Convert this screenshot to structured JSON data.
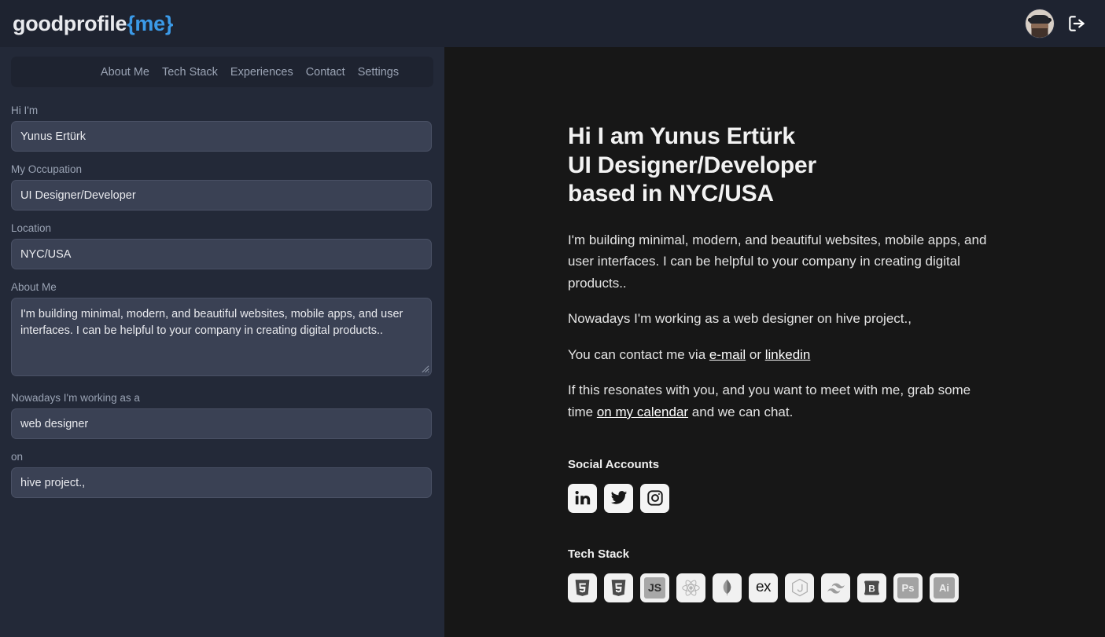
{
  "header": {
    "logo_main": "goodprofile",
    "logo_accent": "{me}",
    "avatar_name": "avatar",
    "logout_name": "logout-icon"
  },
  "nav": {
    "items": [
      {
        "label": "About Me"
      },
      {
        "label": "Tech Stack"
      },
      {
        "label": "Experiences"
      },
      {
        "label": "Contact"
      },
      {
        "label": "Settings"
      }
    ]
  },
  "form": {
    "fields": [
      {
        "label": "Hi I'm",
        "value": "Yunus Ertürk",
        "name": "name-input"
      },
      {
        "label": "My Occupation",
        "value": "UI Designer/Developer",
        "name": "occupation-input"
      },
      {
        "label": "Location",
        "value": "NYC/USA",
        "name": "location-input"
      }
    ],
    "about": {
      "label": "About Me",
      "value": "I'm building minimal, modern, and beautiful websites, mobile apps, and user interfaces. I can be helpful to your company in creating digital products.."
    },
    "working_as": {
      "label": "Nowadays I'm working as a",
      "value": "web designer"
    },
    "working_on": {
      "label": "on",
      "value": "hive project.,"
    }
  },
  "preview": {
    "title_line1": "Hi I am Yunus Ertürk",
    "title_line2": "UI Designer/Developer",
    "title_line3": "based in NYC/USA",
    "para1": "I'm building minimal, modern, and beautiful websites, mobile apps, and user interfaces. I can be helpful to your company in creating digital products..",
    "para2": "Nowadays I'm working as a web designer on hive project.,",
    "para3_pre": "You can contact me via ",
    "para3_link1": "e-mail",
    "para3_mid": " or ",
    "para3_link2": "linkedin",
    "para4_pre": "If this resonates with you, and you want to meet with me, grab some time ",
    "para4_link": "on my calendar",
    "para4_post": " and we can chat.",
    "social_heading": "Social Accounts",
    "social": [
      {
        "name": "linkedin-icon",
        "label": "LinkedIn"
      },
      {
        "name": "twitter-icon",
        "label": "Twitter"
      },
      {
        "name": "instagram-icon",
        "label": "Instagram"
      }
    ],
    "tech_heading": "Tech Stack",
    "tech": [
      {
        "name": "html5-icon",
        "label": "HTML5"
      },
      {
        "name": "css3-icon",
        "label": "CSS3"
      },
      {
        "name": "javascript-icon",
        "label": "JS"
      },
      {
        "name": "react-icon",
        "label": "React"
      },
      {
        "name": "mongodb-icon",
        "label": "MongoDB"
      },
      {
        "name": "express-icon",
        "label": "ex"
      },
      {
        "name": "nodejs-icon",
        "label": "Node.js"
      },
      {
        "name": "tailwind-icon",
        "label": "Tailwind"
      },
      {
        "name": "bootstrap-icon",
        "label": "B"
      },
      {
        "name": "photoshop-icon",
        "label": "Ps"
      },
      {
        "name": "illustrator-icon",
        "label": "Ai"
      }
    ]
  },
  "colors": {
    "accent_blue": "#3b9ae8",
    "header_bg": "#1e2330",
    "sidebar_bg": "#232938",
    "input_bg": "#3a4154",
    "preview_bg": "#171717"
  }
}
